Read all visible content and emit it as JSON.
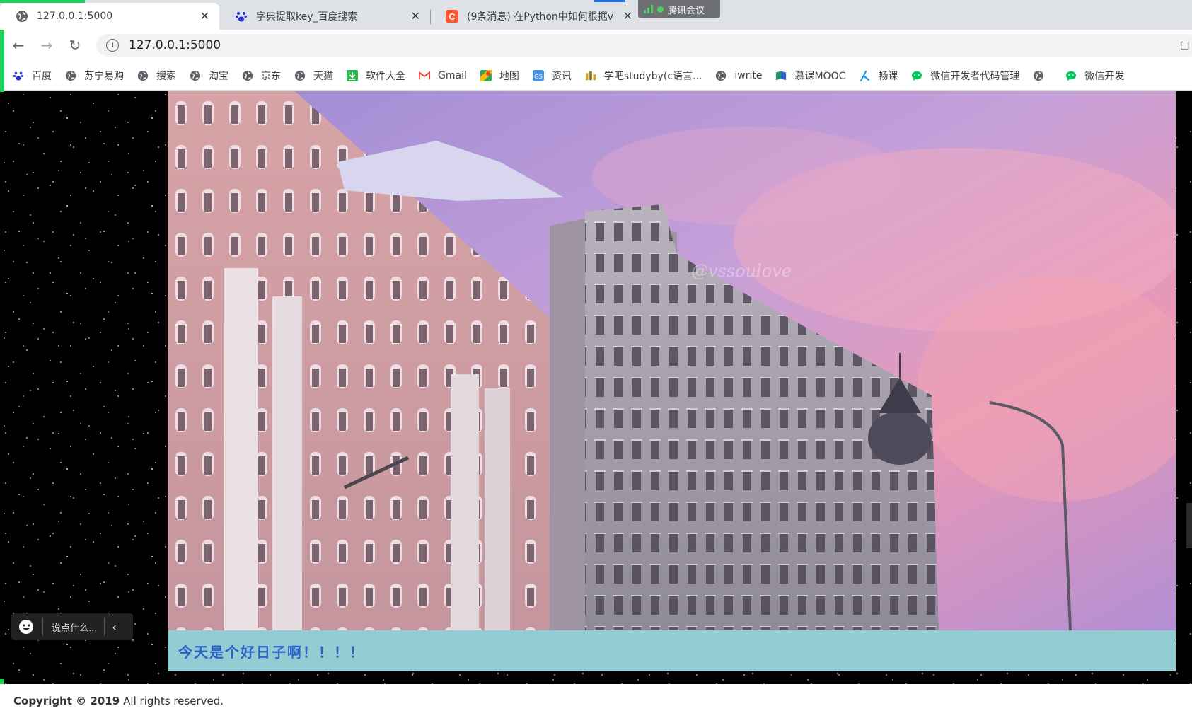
{
  "browser": {
    "tabs": [
      {
        "title": "127.0.0.1:5000",
        "icon": "globe-icon",
        "active": true
      },
      {
        "title": "字典提取key_百度搜索",
        "icon": "baidu-paw-icon",
        "active": false
      },
      {
        "title": "(9条消息) 在Python中如何根据v",
        "icon": "csdn-icon",
        "active": false
      }
    ],
    "meeting_badge": "腾讯会议",
    "url": "127.0.0.1:5000",
    "bookmarks": [
      {
        "label": "百度",
        "icon": "baidu-paw-icon"
      },
      {
        "label": "苏宁易购",
        "icon": "globe-icon"
      },
      {
        "label": "搜索",
        "icon": "globe-icon"
      },
      {
        "label": "淘宝",
        "icon": "globe-icon"
      },
      {
        "label": "京东",
        "icon": "globe-icon"
      },
      {
        "label": "天猫",
        "icon": "globe-icon"
      },
      {
        "label": "软件大全",
        "icon": "download-icon"
      },
      {
        "label": "Gmail",
        "icon": "gmail-icon"
      },
      {
        "label": "地图",
        "icon": "maps-icon"
      },
      {
        "label": "资讯",
        "icon": "news-icon"
      },
      {
        "label": "学吧studyby(c语言...",
        "icon": "studyby-icon"
      },
      {
        "label": "iwrite",
        "icon": "globe-icon"
      },
      {
        "label": "慕课MOOC",
        "icon": "mooc-icon"
      },
      {
        "label": "畅课",
        "icon": "changke-icon"
      },
      {
        "label": "微信开发者代码管理",
        "icon": "wechat-icon"
      },
      {
        "label": "",
        "icon": "globe-icon"
      },
      {
        "label": "微信开发",
        "icon": "wechat-icon"
      }
    ]
  },
  "page": {
    "caption": "今天是个好日子啊！！！！",
    "chat_placeholder": "说点什么...",
    "footer_bold": "Copyright © 2019",
    "footer_text": "All rights reserved."
  },
  "colors": {
    "caption_bg": "#93cdd3",
    "caption_text": "#2a64c8",
    "accent_green": "#1cd05a"
  }
}
